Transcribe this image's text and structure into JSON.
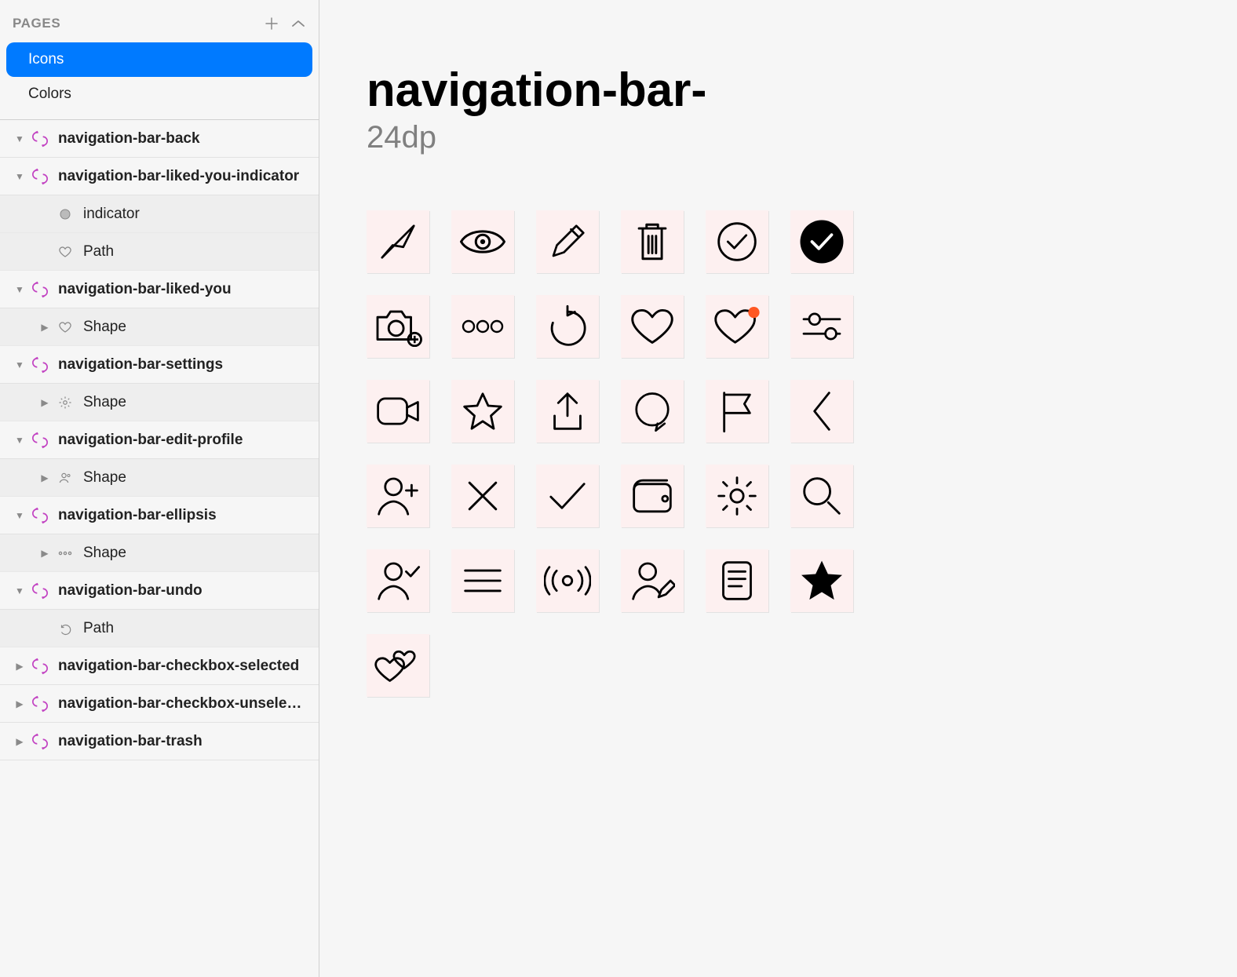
{
  "pages": {
    "header": "PAGES",
    "items": [
      {
        "label": "Icons",
        "selected": true
      },
      {
        "label": "Colors",
        "selected": false
      }
    ]
  },
  "layers": [
    {
      "label": "navigation-bar-back",
      "icon": "symbol",
      "expanded": true,
      "children": []
    },
    {
      "label": "navigation-bar-liked-you-indicator",
      "icon": "symbol",
      "expanded": true,
      "children": [
        {
          "label": "indicator",
          "icon": "circle"
        },
        {
          "label": "Path",
          "icon": "heart"
        }
      ]
    },
    {
      "label": "navigation-bar-liked-you",
      "icon": "symbol",
      "expanded": true,
      "children": [
        {
          "label": "Shape",
          "icon": "heart",
          "disclosure": true
        }
      ]
    },
    {
      "label": "navigation-bar-settings",
      "icon": "symbol",
      "expanded": true,
      "children": [
        {
          "label": "Shape",
          "icon": "gear",
          "disclosure": true
        }
      ]
    },
    {
      "label": "navigation-bar-edit-profile",
      "icon": "symbol",
      "expanded": true,
      "children": [
        {
          "label": "Shape",
          "icon": "person",
          "disclosure": true
        }
      ]
    },
    {
      "label": "navigation-bar-ellipsis",
      "icon": "symbol",
      "expanded": true,
      "children": [
        {
          "label": "Shape",
          "icon": "dots",
          "disclosure": true
        }
      ]
    },
    {
      "label": "navigation-bar-undo",
      "icon": "symbol",
      "expanded": true,
      "children": [
        {
          "label": "Path",
          "icon": "undo"
        }
      ]
    },
    {
      "label": "navigation-bar-checkbox-selected",
      "icon": "symbol",
      "expanded": false,
      "children": []
    },
    {
      "label": "navigation-bar-checkbox-unselect…",
      "icon": "symbol",
      "expanded": false,
      "children": []
    },
    {
      "label": "navigation-bar-trash",
      "icon": "symbol",
      "expanded": false,
      "children": []
    }
  ],
  "canvas": {
    "title": "navigation-bar-",
    "subtitle": "24dp"
  },
  "icons": [
    "send",
    "eye",
    "edit-pencil",
    "trash",
    "check-circle",
    "check-circle-filled",
    "camera-add",
    "ellipsis",
    "undo",
    "heart",
    "heart-indicator",
    "sliders",
    "video",
    "star-outline",
    "share-up",
    "chat",
    "flag",
    "chevron-left",
    "person-add",
    "close-x",
    "checkmark",
    "wallet",
    "gear",
    "search",
    "person-check",
    "menu-lines",
    "broadcast",
    "person-edit",
    "document",
    "star-filled",
    "hearts-double"
  ],
  "colors": {
    "accent": "#007aff",
    "tile": "#fdf0f0",
    "indicator": "#ff5722"
  }
}
